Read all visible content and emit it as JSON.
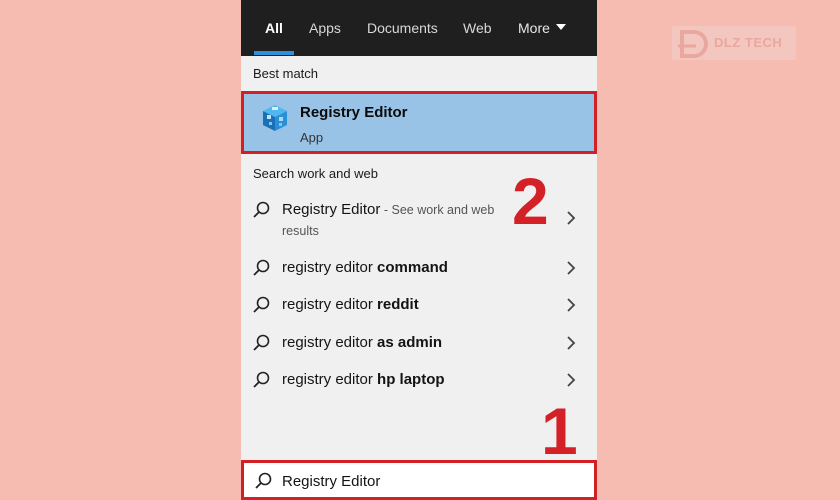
{
  "tabs": [
    {
      "label": "All",
      "active": true
    },
    {
      "label": "Apps"
    },
    {
      "label": "Documents"
    },
    {
      "label": "Web"
    },
    {
      "label": "More"
    }
  ],
  "best_match": {
    "heading": "Best match",
    "app_name": "Registry Editor",
    "app_type": "App",
    "icon": "registry-editor-icon"
  },
  "web_section": {
    "heading": "Search work and web",
    "results": [
      {
        "prefix": "Registry Editor",
        "suffix": " - See work and web",
        "line2": "results"
      },
      {
        "prefix": "registry editor ",
        "bold": "command"
      },
      {
        "prefix": "registry editor ",
        "bold": "reddit"
      },
      {
        "prefix": "registry editor ",
        "bold": "as admin"
      },
      {
        "prefix": "registry editor ",
        "bold": "hp laptop"
      }
    ]
  },
  "search": {
    "value": "Registry Editor"
  },
  "annotations": {
    "step1": "1",
    "step2": "2"
  },
  "watermark": {
    "text": "DLZ TECH"
  },
  "colors": {
    "background": "#f7bcb1",
    "highlight_border": "#d32025",
    "selected_item": "#99c3e6",
    "topbar": "#1f1f1f",
    "tab_accent": "#2f8fd8"
  }
}
